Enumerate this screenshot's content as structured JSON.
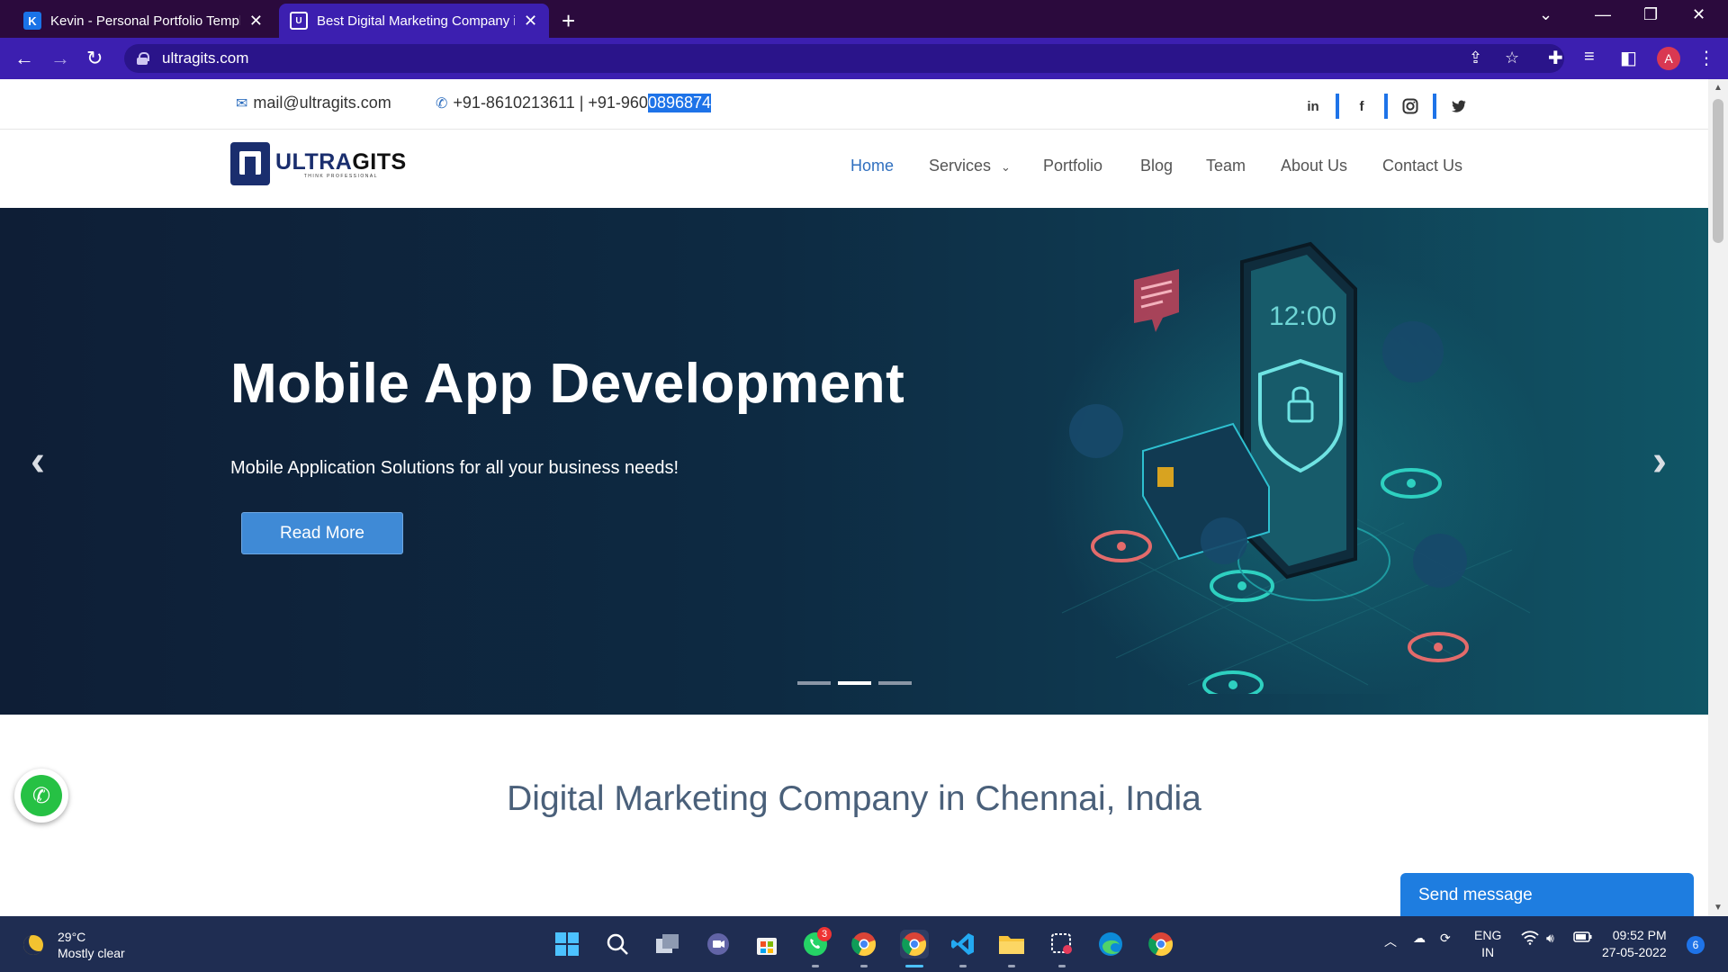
{
  "browser": {
    "tabs": [
      {
        "title": "Kevin - Personal Portfolio Template",
        "favicon": "K"
      },
      {
        "title": "Best Digital Marketing Company in Chennai",
        "favicon": "U"
      }
    ],
    "url": "ultragits.com",
    "profile_initial": "A"
  },
  "topbar": {
    "email": "mail@ultragits.com",
    "phone_prefix": "+91-8610213611 | +91-960",
    "phone_selected": "0896874"
  },
  "logo": {
    "brand_blue": "ULTRA",
    "brand_dark": "GITS",
    "tagline": "THINK PROFESSIONAL"
  },
  "nav": {
    "home": "Home",
    "services": "Services",
    "portfolio": "Portfolio",
    "blog": "Blog",
    "team": "Team",
    "about": "About Us",
    "contact": "Contact Us"
  },
  "hero": {
    "title": "Mobile App Development",
    "subtitle": "Mobile Application Solutions for all your business needs!",
    "button": "Read More",
    "slides_total": 3,
    "active_slide": 2,
    "clock_text": "12:00"
  },
  "section": {
    "title": "Digital Marketing Company in Chennai, India"
  },
  "chat": {
    "send_label": "Send message"
  },
  "taskbar": {
    "temperature": "29°C",
    "weather": "Mostly clear",
    "whatsapp_badge": "3",
    "lang_top": "ENG",
    "lang_bottom": "IN",
    "time": "09:52 PM",
    "date": "27-05-2022",
    "notifications": "6"
  },
  "colors": {
    "accent": "#2f6fbf",
    "chrome": "#3c1fb0",
    "hero_bg": "#0d2a42",
    "button": "#3f8ad6"
  }
}
